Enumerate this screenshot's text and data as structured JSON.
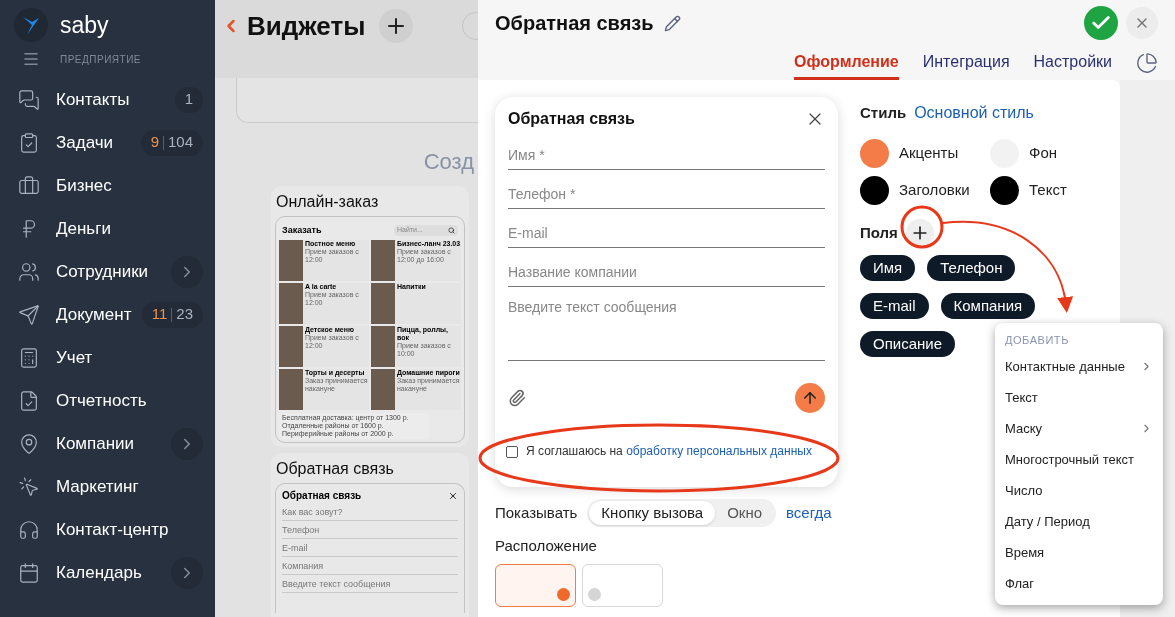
{
  "brand": {
    "logo": "saby",
    "section": "ПРЕДПРИЯТИЕ"
  },
  "nav": [
    {
      "label": "Контакты",
      "count": "1",
      "chevron": false
    },
    {
      "label": "Задачи",
      "accent": "9",
      "count": "104",
      "chevron": false
    },
    {
      "label": "Бизнес",
      "chevron": false
    },
    {
      "label": "Деньги",
      "chevron": false
    },
    {
      "label": "Сотрудники",
      "chevron": true
    },
    {
      "label": "Документ",
      "accent": "11",
      "count": "23",
      "chevron": false
    },
    {
      "label": "Учет",
      "chevron": false
    },
    {
      "label": "Отчетность",
      "chevron": false
    },
    {
      "label": "Компании",
      "chevron": true
    },
    {
      "label": "Маркетинг",
      "chevron": false
    },
    {
      "label": "Контакт-центр",
      "chevron": false
    },
    {
      "label": "Календарь",
      "chevron": true
    }
  ],
  "widgets": {
    "title": "Виджеты",
    "section_heading": "Созд",
    "order_card": {
      "title": "Онлайн-заказ",
      "heading": "Заказать",
      "search_placeholder": "Найти...",
      "items": [
        {
          "title": "Постное меню",
          "note": "Прием заказов с 12:00"
        },
        {
          "title": "Бизнес-ланч 23.03",
          "note": "Прием заказов с 12:00 до 16:00"
        },
        {
          "title": "A la carte",
          "note": "Прием заказов с 12:00"
        },
        {
          "title": "Напитки"
        },
        {
          "title": "Детское меню",
          "note": "Прием заказов с 12:00"
        },
        {
          "title": "Пицца, роллы, вок",
          "note": "Прием заказов с 10:00"
        },
        {
          "title": "Торты и десерты",
          "note": "Заказ принимается накануне"
        },
        {
          "title": "Домашние пироги",
          "note": "Заказ принимается накануне"
        }
      ],
      "notice": [
        "Бесплатная доставка: центр от 1300 р.",
        "Отдаленные районы от 1600 р.",
        "Периферийные районы от 2000 р."
      ]
    },
    "feedback_card": {
      "title": "Обратная связь",
      "heading": "Обратная связь",
      "fields": [
        "Как вас зовут?",
        "Телефон",
        "E-mail",
        "Компания",
        "Введите текст сообщения"
      ]
    }
  },
  "editor": {
    "title": "Обратная связь",
    "tabs": [
      {
        "label": "Оформление",
        "selected": true
      },
      {
        "label": "Интеграция",
        "selected": false
      },
      {
        "label": "Настройки",
        "selected": false
      }
    ],
    "preview": {
      "title": "Обратная связь",
      "fields": [
        {
          "placeholder": "Имя *",
          "kind": "line"
        },
        {
          "placeholder": "Телефон *",
          "kind": "line"
        },
        {
          "placeholder": "E-mail",
          "kind": "line"
        },
        {
          "placeholder": "Название компании",
          "kind": "line"
        },
        {
          "placeholder": "Введите текст сообщения",
          "kind": "area"
        }
      ],
      "consent": {
        "checked": false,
        "text": "Я соглашаюсь на",
        "link": "обработку персональных данных"
      }
    },
    "show": {
      "label": "Показывать",
      "options": [
        {
          "label": "Кнопку вызова",
          "selected": true
        },
        {
          "label": "Окно",
          "selected": false
        }
      ],
      "link": "всегда"
    },
    "position": {
      "label": "Расположение",
      "tiles": [
        {
          "selected": true
        },
        {
          "selected": false
        }
      ]
    },
    "style": {
      "label": "Стиль",
      "value": "Основной стиль"
    },
    "colors": [
      {
        "label": "Акценты",
        "color": "#f47c48"
      },
      {
        "label": "Фон",
        "color": "#f2f2f2"
      },
      {
        "label": "Заголовки",
        "color": "#000000"
      },
      {
        "label": "Текст",
        "color": "#000000"
      }
    ],
    "fields_label": "Поля",
    "chips": [
      "Имя",
      "Телефон",
      "E-mail",
      "Компания",
      "Описание"
    ],
    "menu": {
      "header": "ДОБАВИТЬ",
      "items": [
        {
          "label": "Контактные данные",
          "submenu": true
        },
        {
          "label": "Текст",
          "submenu": false
        },
        {
          "label": "Маску",
          "submenu": true
        },
        {
          "label": "Многострочный текст",
          "submenu": false
        },
        {
          "label": "Число",
          "submenu": false
        },
        {
          "label": "Дату / Период",
          "submenu": false
        },
        {
          "label": "Время",
          "submenu": false
        },
        {
          "label": "Флаг",
          "submenu": false
        }
      ]
    }
  }
}
